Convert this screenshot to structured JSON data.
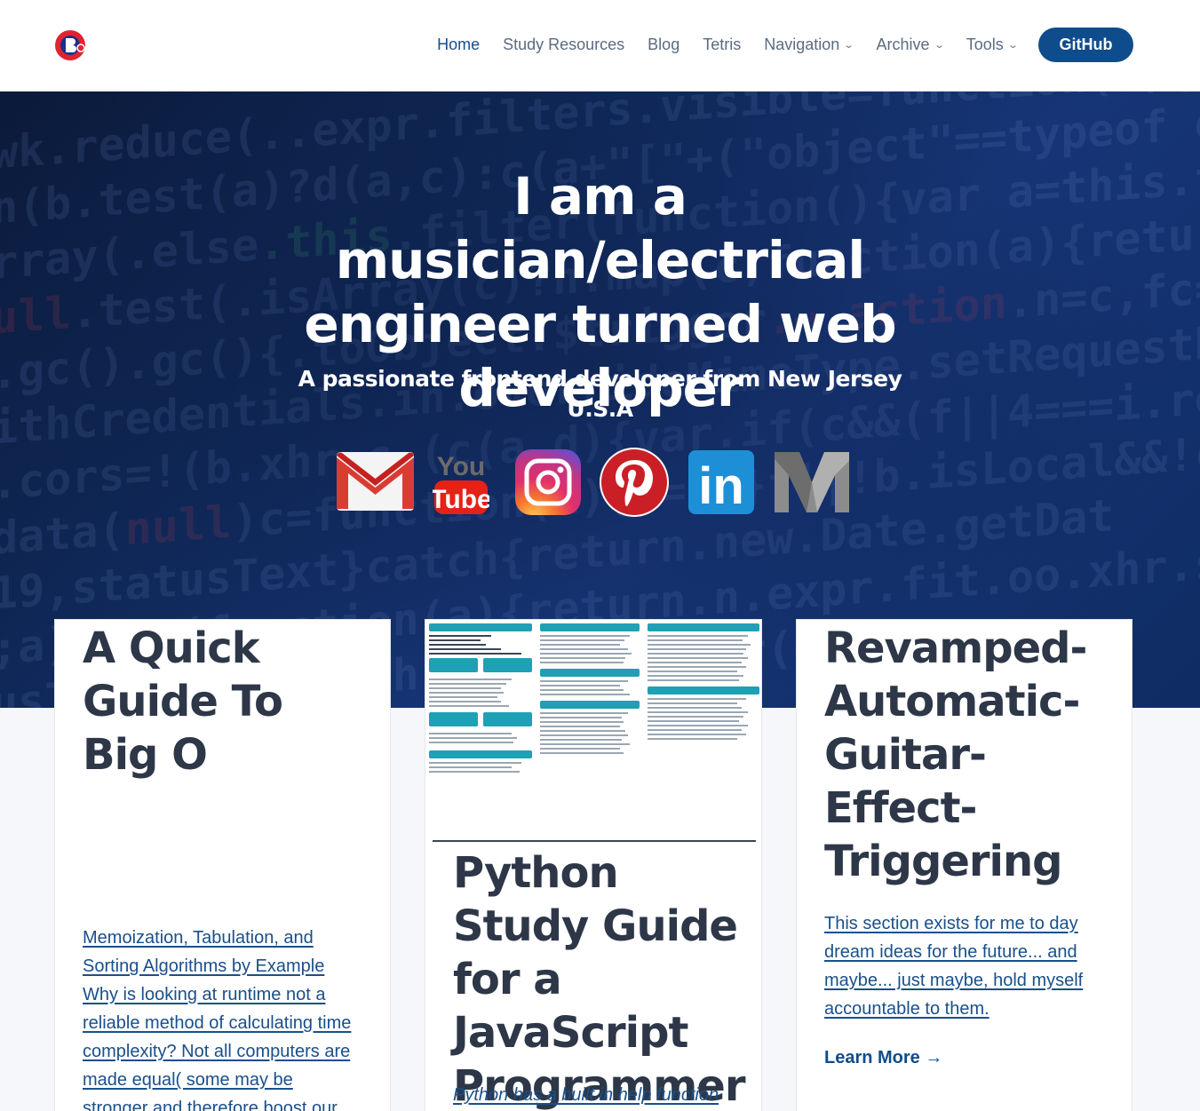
{
  "header": {
    "nav": [
      {
        "label": "Home",
        "dropdown": false,
        "active": true
      },
      {
        "label": "Study Resources",
        "dropdown": false
      },
      {
        "label": "Blog",
        "dropdown": false
      },
      {
        "label": "Tetris",
        "dropdown": false
      },
      {
        "label": "Navigation",
        "dropdown": true
      },
      {
        "label": "Archive",
        "dropdown": true
      },
      {
        "label": "Tools",
        "dropdown": true
      }
    ],
    "github_label": "GitHub",
    "chevron_glyph": "⌄"
  },
  "hero": {
    "title": "I am a musician/electrical engineer turned web developer",
    "subtitle": "A passionate frontend developer from New Jersey U.S.A",
    "socials": [
      "gmail-icon",
      "youtube-icon",
      "instagram-icon",
      "pinterest-icon",
      "linkedin-icon",
      "medium-icon"
    ],
    "youtube_text_top": "You",
    "youtube_text_bottom": "Tube",
    "linkedin_text": "in"
  },
  "cards": [
    {
      "title": "A Quick Guide To Big O",
      "link_text": "Memoization, Tabulation, and Sorting Algorithms by Example Why is looking at runtime not a reliable method of calculating time complexity? Not all computers are made equal( some may be stronger and therefore boost our runtime"
    },
    {
      "title": "Python Study Guide for a JavaScript Programmer",
      "link_text": "Python has a built in help function"
    },
    {
      "title": "Revamped-Automatic-Guitar-Effect-Triggering",
      "link_text": "This section exists for me to day dream ideas for the future... and maybe... just maybe, hold myself accountable to them.",
      "cta": "Learn More →"
    }
  ],
  "colors": {
    "accent": "#0f4c8c",
    "hero_bg": "#102a5c",
    "title_text": "#2d3748"
  }
}
